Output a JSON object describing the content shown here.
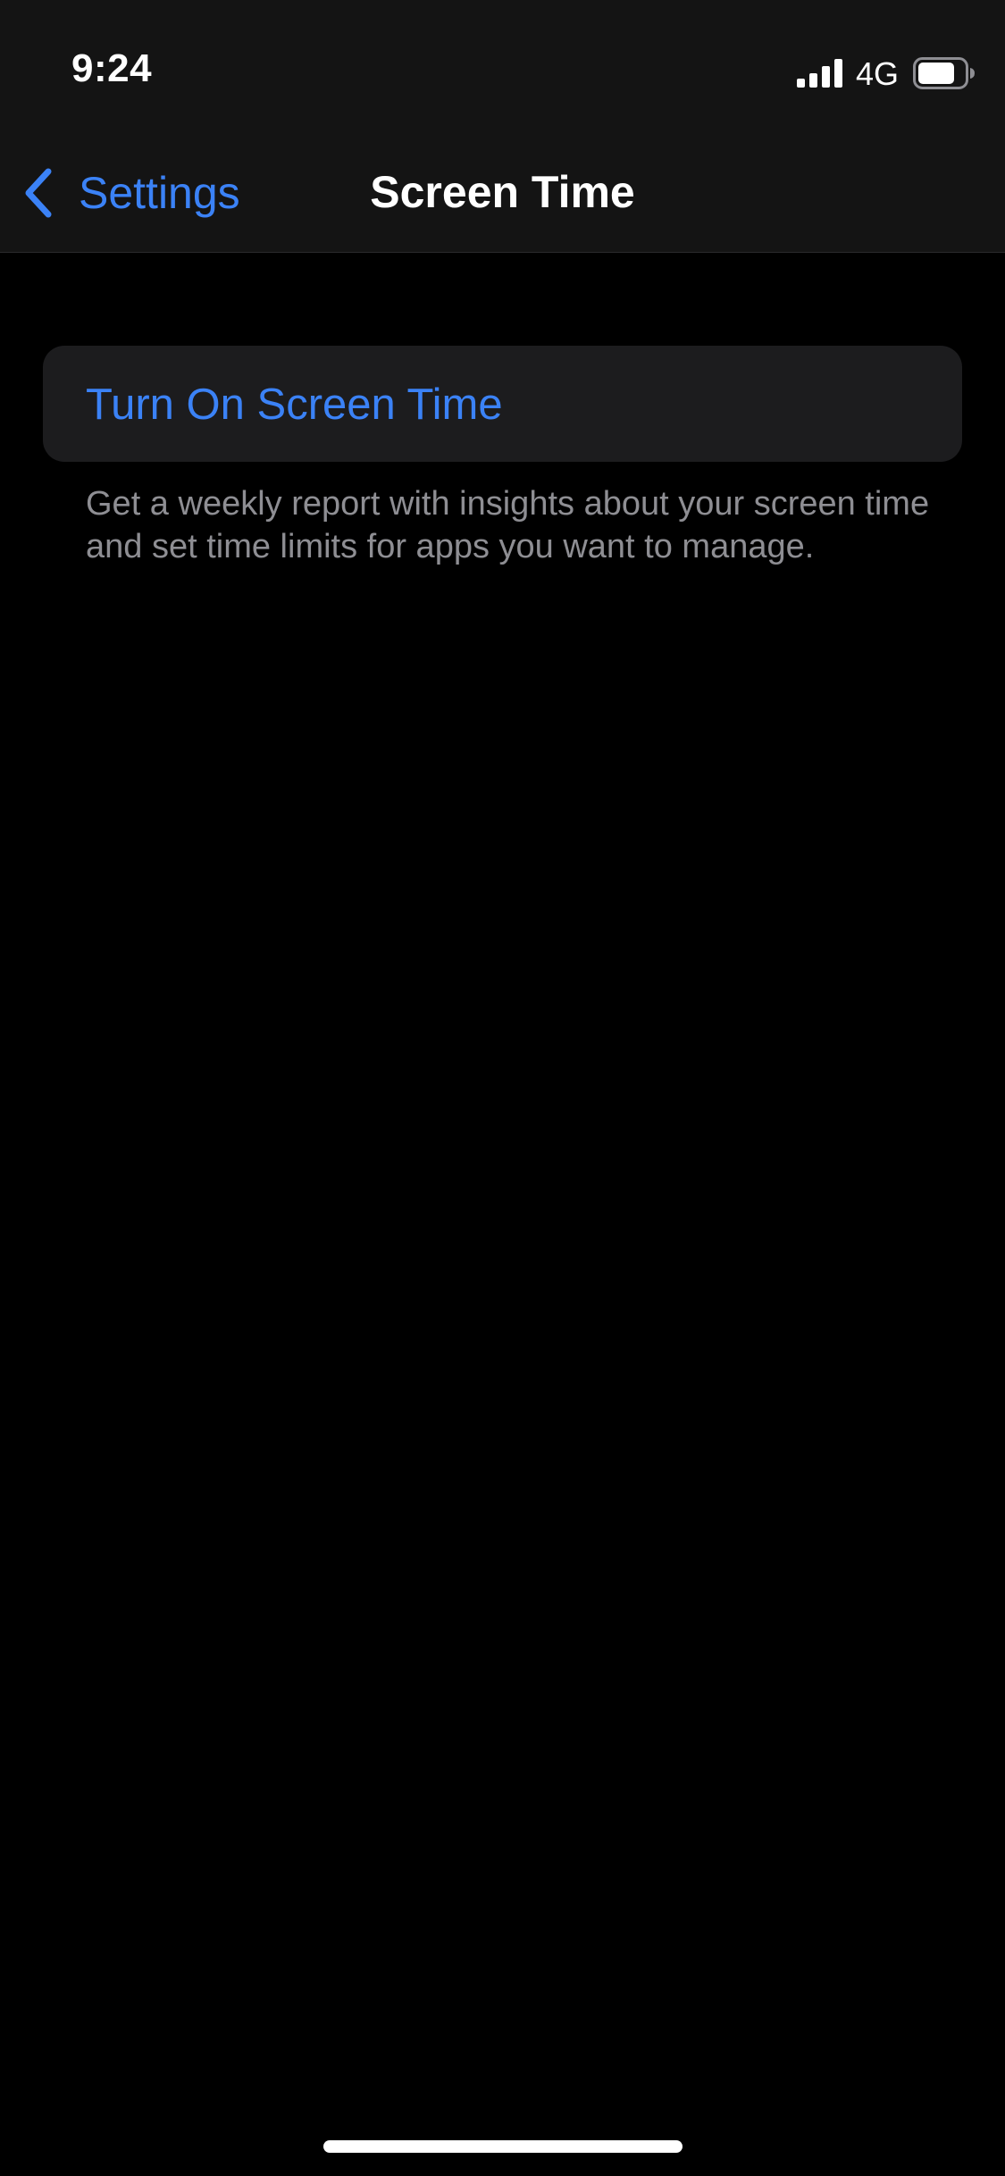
{
  "status_bar": {
    "time": "9:24",
    "network": "4G",
    "signal_icon": "cellular-signal-icon",
    "battery_icon": "battery-icon",
    "battery_level": 0.8
  },
  "nav": {
    "back_label": "Settings",
    "back_icon": "chevron-left-icon",
    "title": "Screen Time"
  },
  "main": {
    "action_label": "Turn On Screen Time",
    "description": "Get a weekly report with insights about your screen time and set time limits for apps you want to manage."
  },
  "colors": {
    "accent": "#3b82f6",
    "background": "#000000",
    "header_background": "#141414",
    "card_background": "#1c1c1e",
    "secondary_text": "#8e8e93"
  }
}
